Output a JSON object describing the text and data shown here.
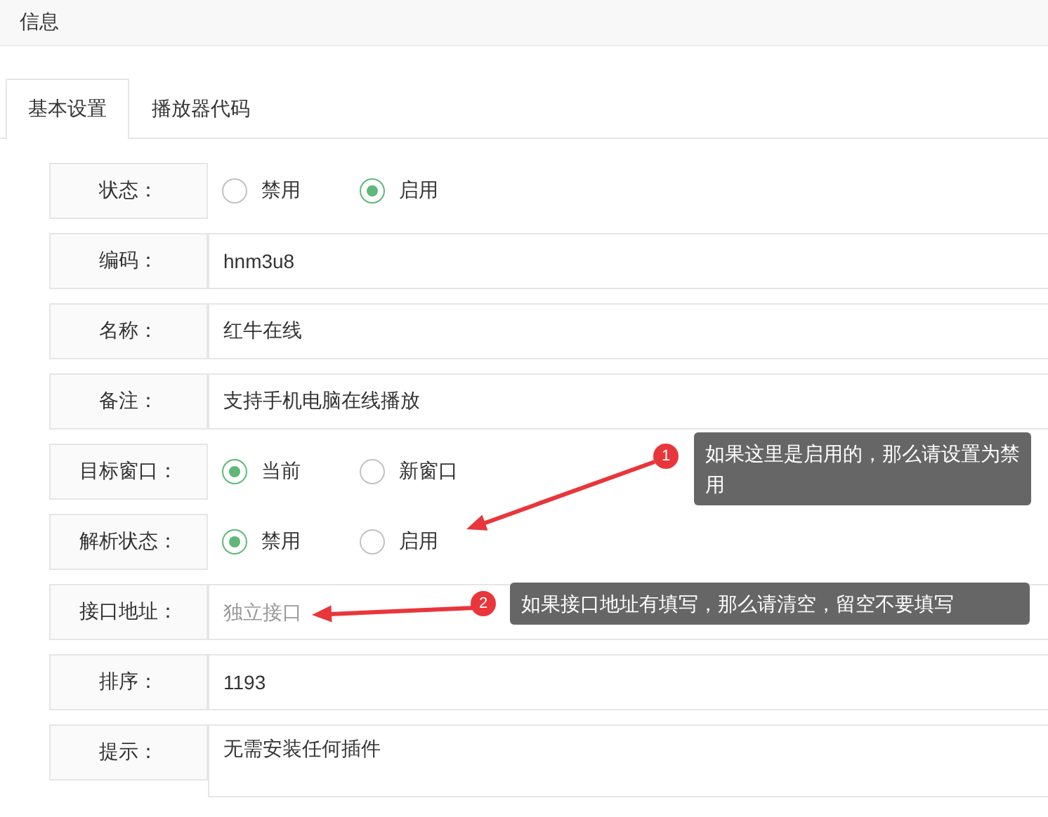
{
  "header": {
    "title": "信息"
  },
  "tabs": [
    {
      "label": "基本设置",
      "selected": true
    },
    {
      "label": "播放器代码",
      "selected": false
    }
  ],
  "fields": [
    {
      "kind": "radio",
      "label": "状态：",
      "options": [
        {
          "label": "禁用",
          "selected": false
        },
        {
          "label": "启用",
          "selected": true
        }
      ]
    },
    {
      "kind": "input",
      "label": "编码：",
      "value": "hnm3u8"
    },
    {
      "kind": "input",
      "label": "名称：",
      "value": "红牛在线"
    },
    {
      "kind": "input",
      "label": "备注：",
      "value": "支持手机电脑在线播放"
    },
    {
      "kind": "radio",
      "label": "目标窗口：",
      "options": [
        {
          "label": "当前",
          "selected": true
        },
        {
          "label": "新窗口",
          "selected": false
        }
      ]
    },
    {
      "kind": "radio",
      "label": "解析状态：",
      "options": [
        {
          "label": "禁用",
          "selected": true
        },
        {
          "label": "启用",
          "selected": false
        }
      ]
    },
    {
      "kind": "input",
      "label": "接口地址：",
      "placeholder": "独立接口"
    },
    {
      "kind": "input",
      "label": "排序：",
      "value": "1193"
    },
    {
      "kind": "textarea",
      "label": "提示：",
      "value": "无需安装任何插件"
    }
  ],
  "annotations": [
    {
      "number": "1",
      "text": "如果这里是启用的，那么请设置为禁用"
    },
    {
      "number": "2",
      "text": "如果接口地址有填写，那么请清空，留空不要填写"
    }
  ]
}
